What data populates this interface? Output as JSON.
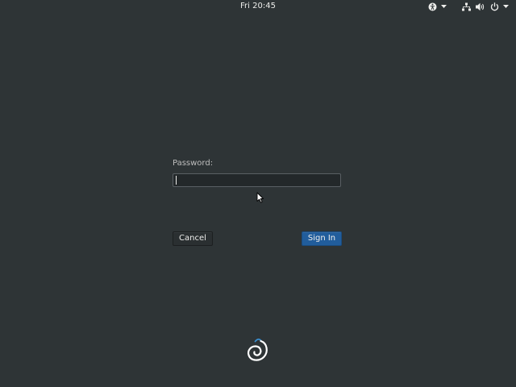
{
  "topbar": {
    "clock": "Fri 20:45",
    "icons": {
      "accessibility": "accessibility-icon",
      "accessibility_menu": "chevron-down-icon",
      "network": "network-wired-icon",
      "volume": "volume-icon",
      "power": "power-icon",
      "system_menu": "chevron-down-icon"
    }
  },
  "login": {
    "password_label": "Password:",
    "password_value": "",
    "cancel_label": "Cancel",
    "signin_label": "Sign In"
  },
  "logo": {
    "icon": "debian-swirl-icon"
  },
  "colors": {
    "background": "#2e3436",
    "accent": "#215d9c",
    "text": "#eeeeec"
  }
}
